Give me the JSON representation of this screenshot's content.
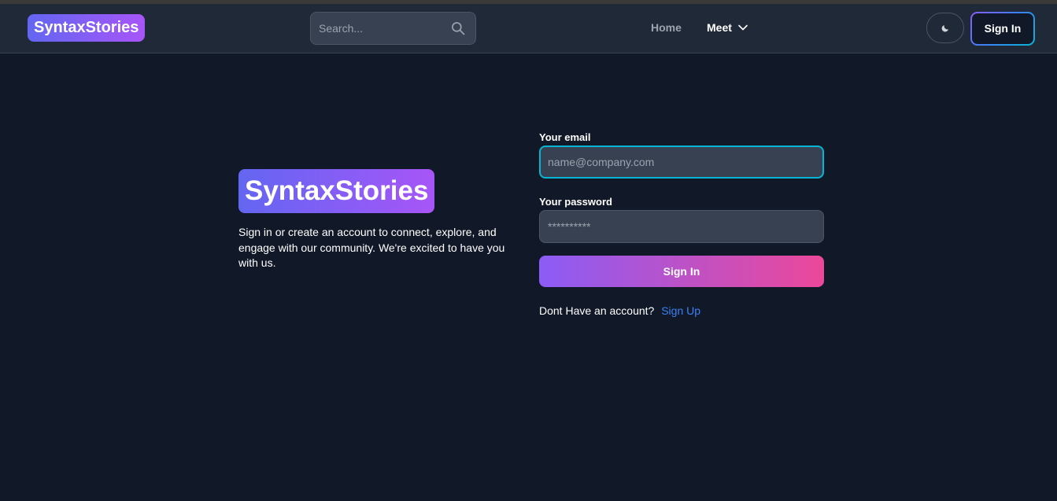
{
  "navbar": {
    "logo": "SyntaxStories",
    "search_placeholder": "Search...",
    "links": {
      "home": "Home",
      "meet": "Meet"
    },
    "signin_label": "Sign In"
  },
  "hero": {
    "logo": "SyntaxStories",
    "description": "Sign in or create an account to connect, explore, and engage with our community. We're excited to have you with us."
  },
  "form": {
    "email_label": "Your email",
    "email_placeholder": "name@company.com",
    "password_label": "Your password",
    "password_placeholder": "**********",
    "submit_label": "Sign In",
    "no_account_text": "Dont Have an account?",
    "signup_link": "Sign Up"
  },
  "colors": {
    "background": "#111827",
    "navbar": "#1f2937",
    "input": "#374151",
    "focus_ring": "#06b6d4",
    "link": "#3b82f6",
    "gradient_start": "#8b5cf6",
    "gradient_end": "#ec4899"
  },
  "icons": {
    "search": "search-icon",
    "dropdown": "chevron-down-icon",
    "theme": "moon-icon"
  }
}
